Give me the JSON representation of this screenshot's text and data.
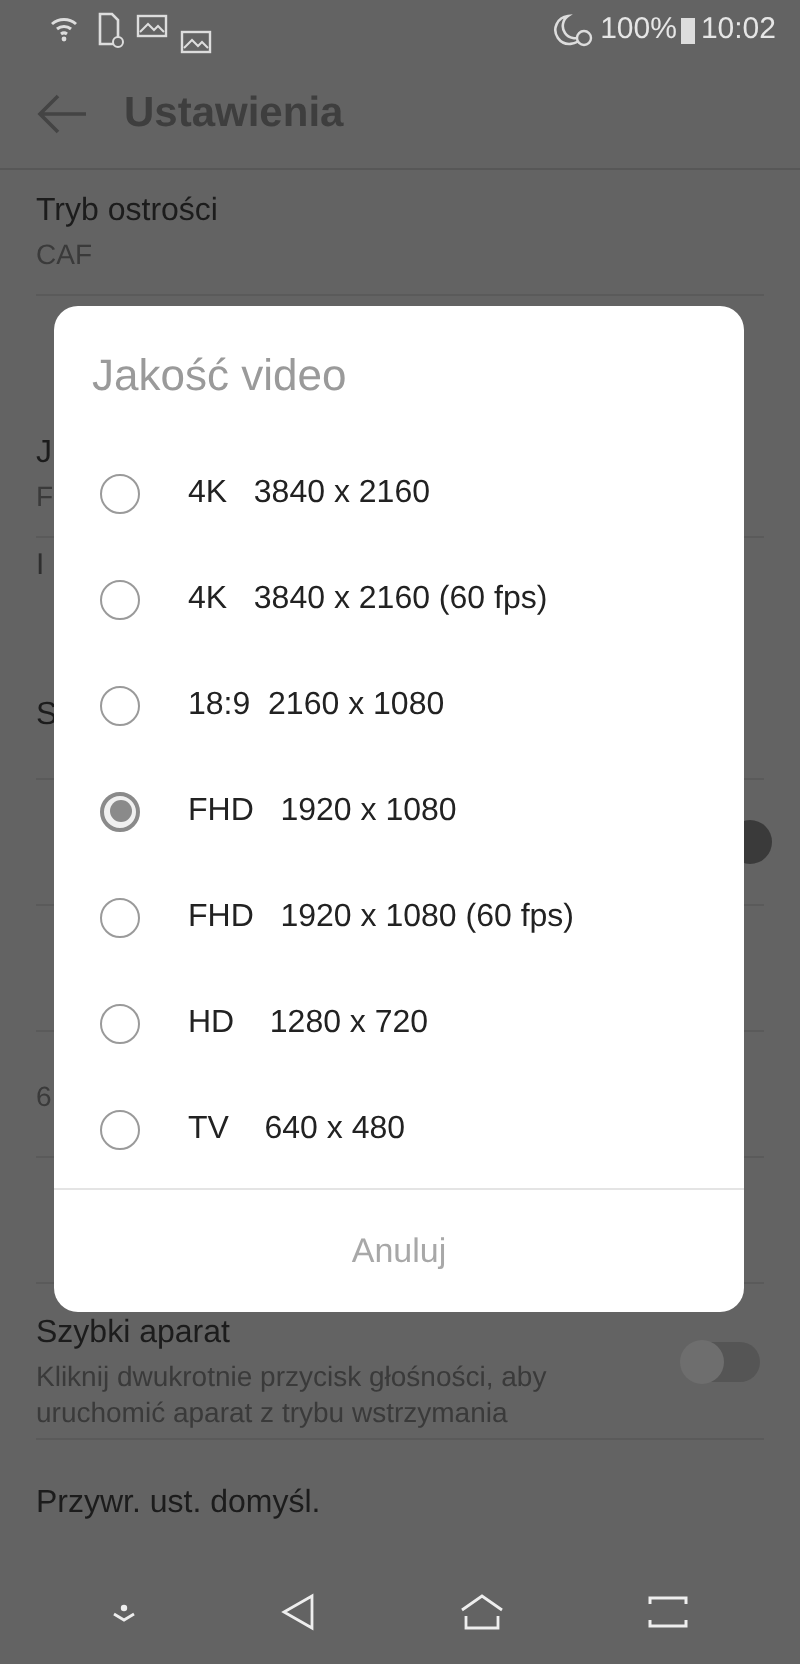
{
  "status_bar": {
    "battery": "100%",
    "time": "10:02"
  },
  "app_bar": {
    "title": "Ustawienia"
  },
  "settings": [
    {
      "kind": "item",
      "title": "Tryb ostrości",
      "subtitle": "CAF"
    },
    {
      "kind": "section"
    },
    {
      "kind": "item",
      "title": "J",
      "subtitle": "F"
    },
    {
      "kind": "section",
      "title": "I"
    },
    {
      "kind": "item",
      "title": "S"
    },
    {
      "kind": "toggle",
      "on": true
    },
    {
      "kind": "item"
    },
    {
      "kind": "item",
      "subtitle": "6"
    },
    {
      "kind": "item"
    },
    {
      "kind": "toggle",
      "title": "Szybki aparat",
      "subtitle": "Kliknij dwukrotnie przycisk głośności, aby uruchomić aparat z trybu wstrzymania",
      "on": false
    },
    {
      "kind": "item",
      "title": "Przywr. ust. domyśl."
    }
  ],
  "dialog": {
    "title": "Jakość video",
    "options": [
      {
        "label": "4K   3840 x 2160",
        "selected": false
      },
      {
        "label": "4K   3840 x 2160 (60 fps)",
        "selected": false
      },
      {
        "label": "18:9  2160 x 1080",
        "selected": false
      },
      {
        "label": "FHD   1920 x 1080",
        "selected": true
      },
      {
        "label": "FHD   1920 x 1080 (60 fps)",
        "selected": false
      },
      {
        "label": "HD    1280 x 720",
        "selected": false
      },
      {
        "label": "TV    640 x 480",
        "selected": false
      }
    ],
    "cancel": "Anuluj"
  }
}
